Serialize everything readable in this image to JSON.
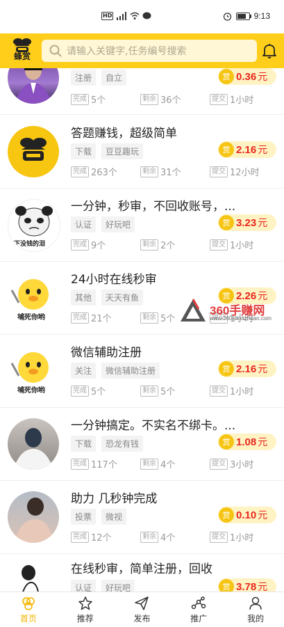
{
  "status_bar": {
    "left_icons": [
      "hd-icon",
      "signal-icon",
      "wifi-icon",
      "message-icon"
    ],
    "alarm_icon": "alarm-icon",
    "battery_icon": "battery-icon",
    "time": "9:13"
  },
  "header": {
    "logo_text": "蜂赏",
    "search_placeholder": "请输入关键字,任务编号搜索",
    "bell_icon": "bell-icon"
  },
  "tasks": [
    {
      "title": "",
      "tags": [
        "注册",
        "自立"
      ],
      "reward": "0.36",
      "unit": "元",
      "reward_icon": "赏",
      "done_label": "完成",
      "done": "5个",
      "remain_label": "剩余",
      "remain": "36个",
      "submit_label": "提交",
      "submit": "1小时"
    },
    {
      "title": "答题赚钱，超级简单",
      "tags": [
        "下载",
        "豆豆趣玩"
      ],
      "reward": "2.16",
      "unit": "元",
      "reward_icon": "赏",
      "done_label": "完成",
      "done": "263个",
      "remain_label": "剩余",
      "remain": "31个",
      "submit_label": "提交",
      "submit": "12小时"
    },
    {
      "title": "一分钟，秒审，不回收账号，...",
      "tags": [
        "认证",
        "好玩吧"
      ],
      "reward": "3.23",
      "unit": "元",
      "reward_icon": "赏",
      "done_label": "完成",
      "done": "9个",
      "remain_label": "剩余",
      "remain": "2个",
      "submit_label": "提交",
      "submit": "1小时",
      "avatar_caption": "下没钱的泪"
    },
    {
      "title": "24小时在线秒审",
      "tags": [
        "其他",
        "天天有鱼"
      ],
      "reward": "2.26",
      "unit": "元",
      "reward_icon": "赏",
      "done_label": "完成",
      "done": "21个",
      "remain_label": "剩余",
      "remain": "5个",
      "submit_label": "提交",
      "submit": "1小时",
      "avatar_caption": "捕死你哟"
    },
    {
      "title": "微信辅助注册",
      "tags": [
        "关注",
        "微信辅助注册"
      ],
      "reward": "2.16",
      "unit": "元",
      "reward_icon": "赏",
      "done_label": "完成",
      "done": "5个",
      "remain_label": "剩余",
      "remain": "5个",
      "submit_label": "提交",
      "submit": "1小时",
      "avatar_caption": "捕死你哟"
    },
    {
      "title": "一分钟搞定。不实名不绑卡。...",
      "tags": [
        "下载",
        "恐龙有钱"
      ],
      "reward": "1.08",
      "unit": "元",
      "reward_icon": "赏",
      "done_label": "完成",
      "done": "117个",
      "remain_label": "剩余",
      "remain": "4个",
      "submit_label": "提交",
      "submit": "3小时"
    },
    {
      "title": "助力 几秒钟完成",
      "tags": [
        "投票",
        "微视"
      ],
      "reward": "0.10",
      "unit": "元",
      "reward_icon": "赏",
      "done_label": "完成",
      "done": "12个",
      "remain_label": "剩余",
      "remain": "4个",
      "submit_label": "提交",
      "submit": "1小时"
    },
    {
      "title": "在线秒审，简单注册，回收",
      "tags": [
        "认证",
        "好玩吧"
      ],
      "reward": "3.78",
      "unit": "元",
      "reward_icon": "赏",
      "done_label": "",
      "done": "",
      "remain_label": "",
      "remain": "",
      "submit_label": "",
      "submit": ""
    }
  ],
  "watermark": {
    "text": "360手赚网",
    "sub": "www.360shouzhuan.com"
  },
  "bottom_nav": [
    {
      "label": "首页",
      "icon": "home-icon",
      "active": true
    },
    {
      "label": "推荐",
      "icon": "star-icon",
      "active": false
    },
    {
      "label": "发布",
      "icon": "send-icon",
      "active": false
    },
    {
      "label": "推广",
      "icon": "share-icon",
      "active": false
    },
    {
      "label": "我的",
      "icon": "user-icon",
      "active": false
    }
  ],
  "colors": {
    "accent": "#ffce1a",
    "reward_red": "#e9261b",
    "reward_badge": "#f6c514",
    "nav_active": "#f2b400"
  }
}
